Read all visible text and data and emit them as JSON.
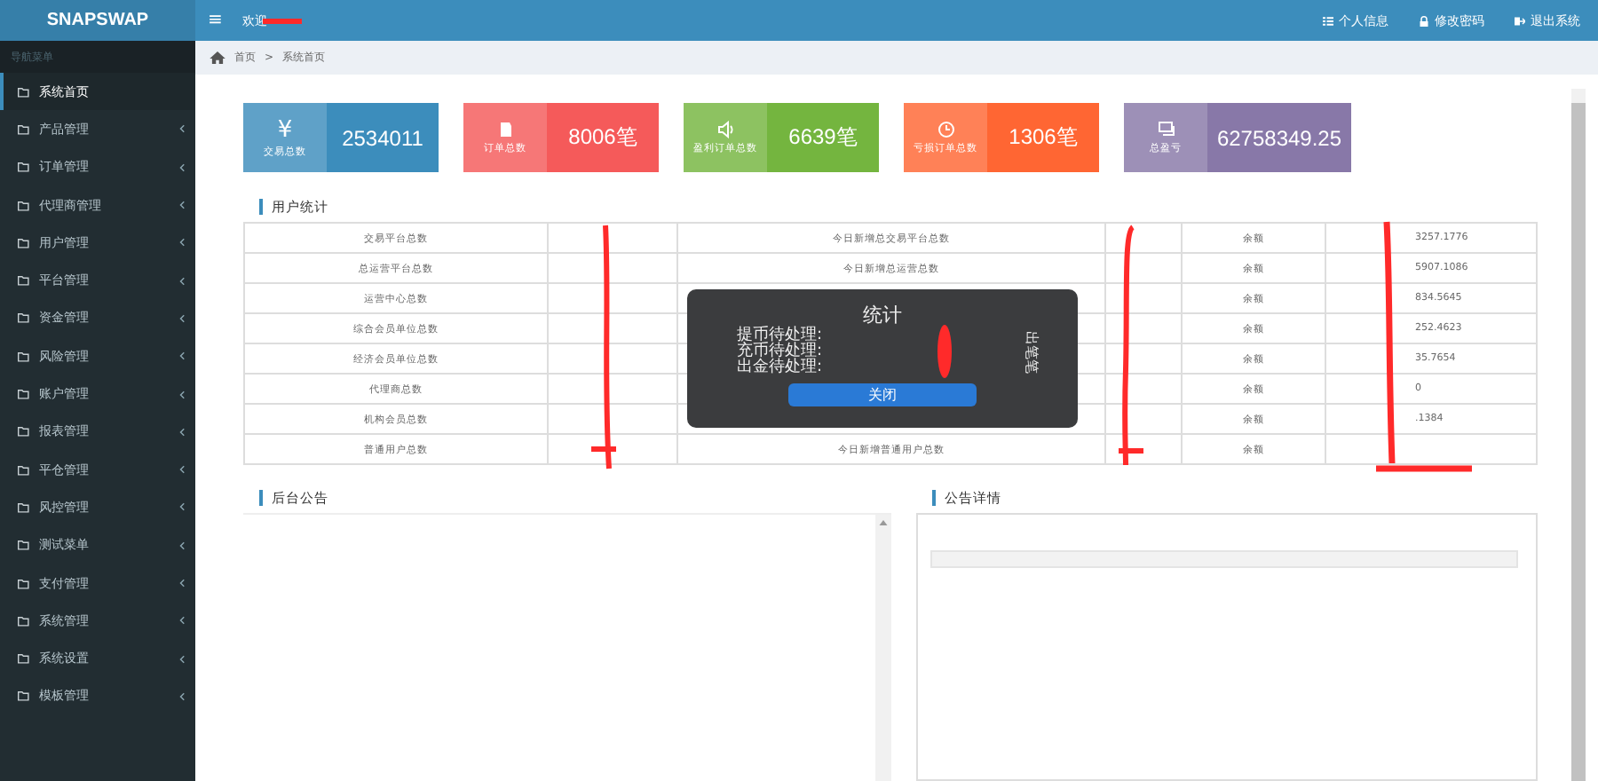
{
  "brand": "SNAPSWAP",
  "header": {
    "menu_icon": "≡",
    "welcome": "欢迎",
    "links": [
      {
        "kind": "list",
        "label": "个人信息"
      },
      {
        "kind": "lock",
        "label": "修改密码"
      },
      {
        "kind": "exit",
        "label": "退出系统"
      }
    ]
  },
  "sidebar": {
    "heading": "导航菜单",
    "items": [
      {
        "label": "系统首页",
        "selected": true,
        "expandable": false
      },
      {
        "label": "产品管理",
        "selected": false,
        "expandable": true
      },
      {
        "label": "订单管理",
        "selected": false,
        "expandable": true
      },
      {
        "label": "代理商管理",
        "selected": false,
        "expandable": true
      },
      {
        "label": "用户管理",
        "selected": false,
        "expandable": true
      },
      {
        "label": "平台管理",
        "selected": false,
        "expandable": true
      },
      {
        "label": "资金管理",
        "selected": false,
        "expandable": true
      },
      {
        "label": "风险管理",
        "selected": false,
        "expandable": true
      },
      {
        "label": "账户管理",
        "selected": false,
        "expandable": true
      },
      {
        "label": "报表管理",
        "selected": false,
        "expandable": true
      },
      {
        "label": "平仓管理",
        "selected": false,
        "expandable": true
      },
      {
        "label": "风控管理",
        "selected": false,
        "expandable": true
      },
      {
        "label": "测试菜单",
        "selected": false,
        "expandable": true
      },
      {
        "label": "支付管理",
        "selected": false,
        "expandable": true
      },
      {
        "label": "系统管理",
        "selected": false,
        "expandable": true
      },
      {
        "label": "系统设置",
        "selected": false,
        "expandable": true
      },
      {
        "label": "模板管理",
        "selected": false,
        "expandable": true
      }
    ]
  },
  "breadcrumb": [
    "首页",
    "系统首页"
  ],
  "breadcrumb_separator": ">",
  "stats": [
    {
      "kind": "yen",
      "icon": "¥",
      "label": "交易总数",
      "value": "2534011",
      "color": "#3c8dbc"
    },
    {
      "kind": "doc",
      "label": "订单总数",
      "value": "8006笔",
      "color": "#f55a5a"
    },
    {
      "kind": "sound",
      "label": "盈利订单总数",
      "value": "6639笔",
      "color": "#74b53f"
    },
    {
      "kind": "clock",
      "label": "亏损订单总数",
      "value": "1306笔",
      "color": "#ff6633"
    },
    {
      "kind": "chat",
      "label": "总盈亏",
      "value": "62758349.25",
      "color": "#8878a8"
    }
  ],
  "user_stats": {
    "title": "用户统计",
    "rows": [
      {
        "label": "交易平台总数",
        "new_label": "今日新增总交易平台总数",
        "balance_label": "余额",
        "balance": "3257.1776"
      },
      {
        "label": "总运营平台总数",
        "new_label": "今日新增总运营总数",
        "balance_label": "余额",
        "balance": "5907.1086"
      },
      {
        "label": "运营中心总数",
        "balance_label": "余额",
        "balance": "834.5645"
      },
      {
        "label": "综合会员单位总数",
        "balance_label": "余额",
        "balance": "252.4623"
      },
      {
        "label": "经济会员单位总数",
        "balance_label": "余额",
        "balance": "35.7654"
      },
      {
        "label": "代理商总数",
        "balance_label": "余额",
        "balance": "0"
      },
      {
        "label": "机构会员总数",
        "balance_label": "余额",
        "balance": ".1384"
      },
      {
        "label": "普通用户总数",
        "new_label": "今日新增普通用户总数",
        "balance_label": "余额"
      }
    ]
  },
  "dialog": {
    "title": "统计",
    "lines": [
      "提币待处理:",
      "充币待处理:",
      "出金待处理:"
    ],
    "side_text": "出笔笔",
    "button": "关闭"
  },
  "panels": [
    {
      "title": "后台公告"
    },
    {
      "title": "公告详情"
    }
  ]
}
